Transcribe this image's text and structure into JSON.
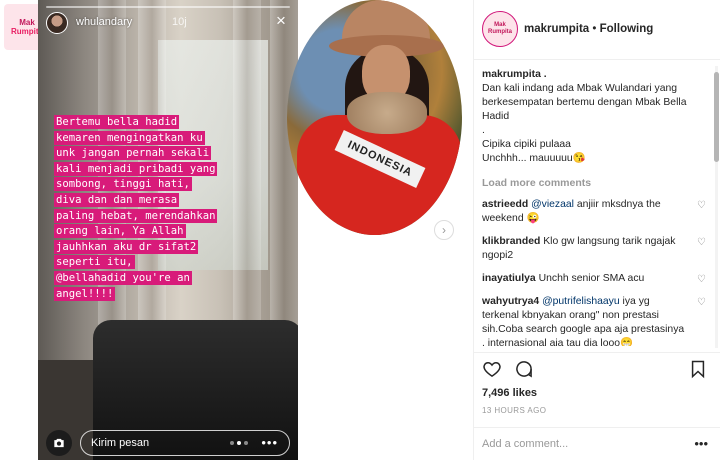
{
  "story": {
    "badge_line1": "Mak",
    "badge_line2": "Rumpita",
    "username": "whulandary",
    "time": "10j",
    "close_icon": "×",
    "caption_lines": [
      "Bertemu bella hadid",
      "kemaren mengingatkan ku",
      "unk jangan pernah sekali",
      "kali menjadi pribadi yang",
      "sombong, tinggi hati,",
      "diva dan dan merasa",
      "paling hebat, merendahkan",
      "orang lain, Ya Allah",
      "jauhhkan aku dr sifat2",
      "seperti itu,",
      "@bellahadid you're an",
      "angel!!!!"
    ],
    "reply_placeholder": "Kirim pesan",
    "more_icon": "•••"
  },
  "photo": {
    "sash_text": "INDONESIA"
  },
  "post": {
    "handle": "makrumpita",
    "separator": "•",
    "follow_status": "Following",
    "caption_user": "makrumpita .",
    "caption_lines": [
      "Dan kali indang ada Mbak Wulandari yang berkesempatan bertemu dengan Mbak Bella Hadid",
      ".",
      "Cipika cipiki pulaaa",
      "Unchhh... mauuuuu😘"
    ],
    "load_more": "Load more comments",
    "comments": [
      {
        "user": "astrieedd",
        "mention": "@viezaal",
        "text": " anjiir mksdnya the weekend 😜"
      },
      {
        "user": "klikbranded",
        "mention": "",
        "text": " Klo gw langsung tarik ngajak ngopi2"
      },
      {
        "user": "inayatiulya",
        "mention": "",
        "text": " Unchh senior SMA acu"
      },
      {
        "user": "wahyutrya4",
        "mention": "@putrifelishaayu",
        "text": " iya yg terkenal kbnyakan orang\" non prestasi sih.Coba search google apa aja prestasinya , internasional aja tau dia looo😁"
      }
    ],
    "likes": "7,496 likes",
    "time_ago": "13 HOURS AGO",
    "add_comment_placeholder": "Add a comment...",
    "options_icon": "•••"
  }
}
